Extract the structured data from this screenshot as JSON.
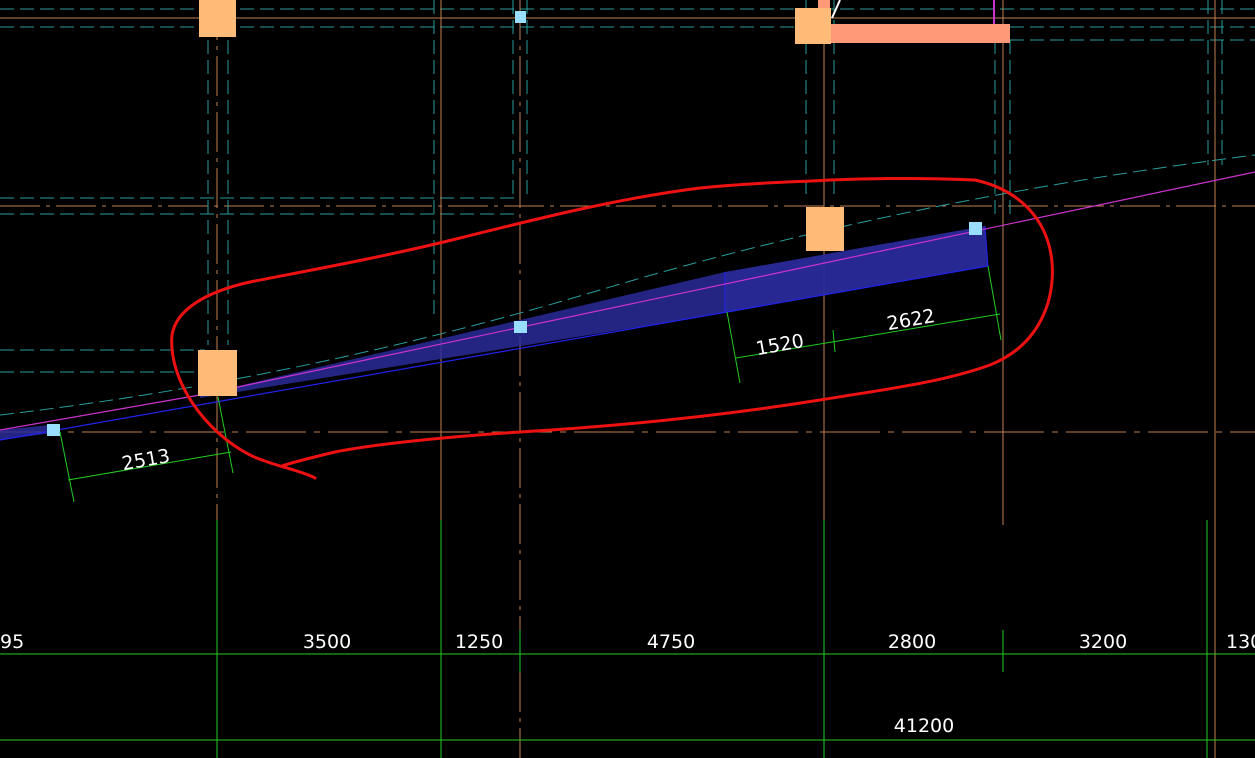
{
  "colors": {
    "background": "#000000",
    "grid_orange": "#c08050",
    "grid_cyan_dash": "#2a9c9c",
    "dimension_green": "#22cc22",
    "column_fill": "#ffbb77",
    "beam_fill": "#ff9977",
    "slab_edge_magenta": "#cc33cc",
    "slab_edge_blue": "#2222ee",
    "hatch_blue": "#2a2a9a",
    "markup_red": "#ee1111",
    "point_marker": "#99ddff",
    "text_white": "#ffffff"
  },
  "dimensions": {
    "bottom_chain": [
      "95",
      "3500",
      "1250",
      "4750",
      "2800",
      "3200",
      "130"
    ],
    "total": "41200",
    "local_left": "2513",
    "local_right_a": "1520",
    "local_right_b": "2622"
  }
}
